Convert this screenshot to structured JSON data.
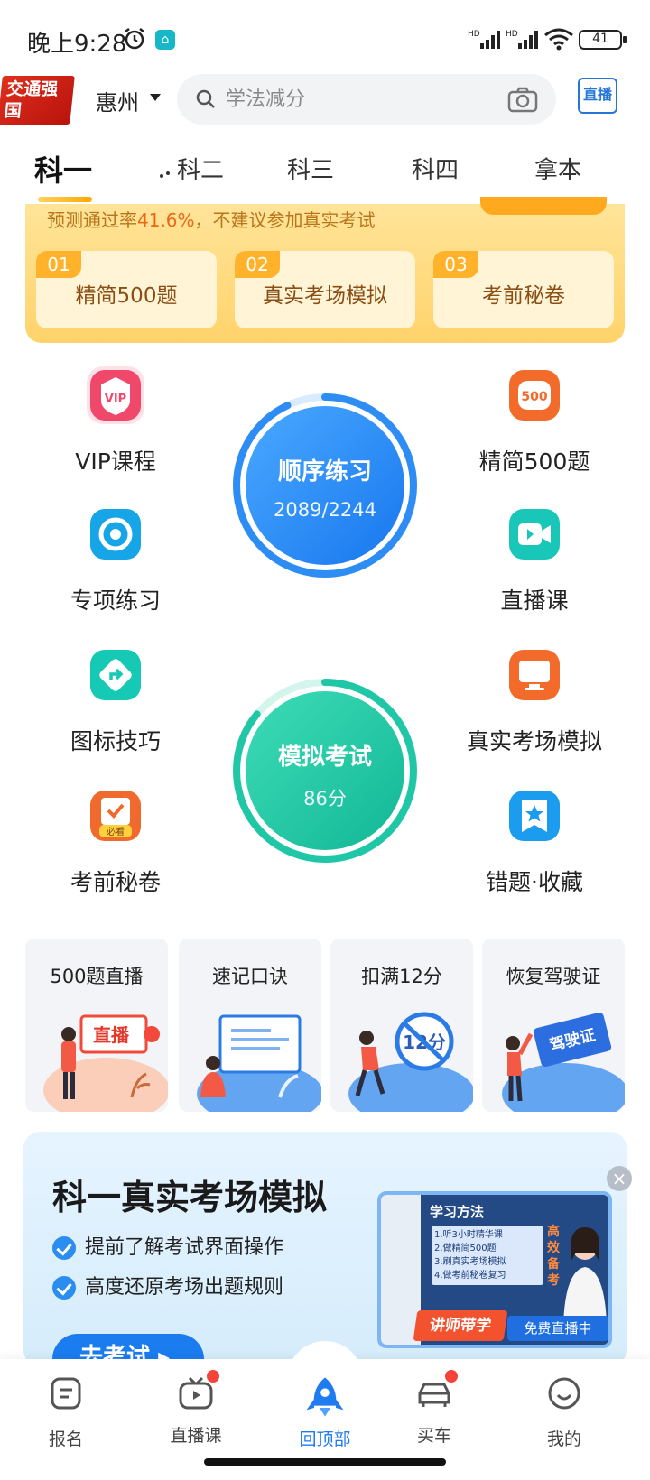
{
  "status_bar": {
    "time": "晚上9:28",
    "signal1": "HD",
    "signal2": "HD",
    "battery": "41"
  },
  "header": {
    "logo_text": "交通强国",
    "city": "惠州",
    "search_placeholder": "学法减分",
    "live_label": "直播"
  },
  "tabs": [
    {
      "label": "科一",
      "active": true
    },
    {
      "label": "科二",
      "active": false
    },
    {
      "label": "科三",
      "active": false
    },
    {
      "label": "科四",
      "active": false
    },
    {
      "label": "拿本",
      "active": false
    }
  ],
  "prediction": {
    "text_before": "预测通过率",
    "rate": "41.6%",
    "text_after": "，不建议参加真实考试",
    "tiles": [
      {
        "num": "01",
        "label": "精简500题"
      },
      {
        "num": "02",
        "label": "真实考场模拟"
      },
      {
        "num": "03",
        "label": "考前秘卷"
      }
    ]
  },
  "grid": {
    "left": [
      {
        "label": "VIP课程",
        "icon": "vip-icon",
        "color": "#f0486a"
      },
      {
        "label": "专项练习",
        "icon": "target-icon",
        "color": "#16a5e6"
      },
      {
        "label": "图标技巧",
        "icon": "sign-arrow-icon",
        "color": "#15c9b4"
      },
      {
        "label": "考前秘卷",
        "icon": "exam-paper-icon",
        "color": "#f06a2e"
      }
    ],
    "right": [
      {
        "label": "精简500题",
        "icon": "500-icon",
        "color": "#f26b2b"
      },
      {
        "label": "直播课",
        "icon": "video-icon",
        "color": "#18c7b8"
      },
      {
        "label": "真实考场模拟",
        "icon": "monitor-icon",
        "color": "#f26b2b"
      },
      {
        "label": "错题·收藏",
        "icon": "star-bookmark-icon",
        "color": "#1b9cee"
      }
    ],
    "sequence": {
      "title": "顺序练习",
      "value": "2089/2244",
      "progress": 0.93
    },
    "mock": {
      "title": "模拟考试",
      "value": "86分",
      "progress": 0.86
    }
  },
  "features": [
    {
      "title": "500题直播",
      "art_text": "直播"
    },
    {
      "title": "速记口诀",
      "art_text": ""
    },
    {
      "title": "扣满12分",
      "art_text": "12分"
    },
    {
      "title": "恢复驾驶证",
      "art_text": "驾驶证"
    }
  ],
  "promo": {
    "title": "科一真实考场模拟",
    "points": [
      "提前了解考试界面操作",
      "高度还原考场出题规则"
    ],
    "cta": "去考试",
    "video_title": "学习方法",
    "video_steps": [
      "1.听3小时精华课",
      "2.做精简500题",
      "3.刷真实考场模拟",
      "4.做考前秘卷复习"
    ],
    "video_side": "高效备考",
    "video_banner": "讲师带学",
    "video_badge": "免费直播中"
  },
  "bottom_nav": [
    {
      "label": "报名",
      "icon": "form-icon",
      "dot": false,
      "active": false
    },
    {
      "label": "直播课",
      "icon": "tv-icon",
      "dot": true,
      "active": false
    },
    {
      "label": "回顶部",
      "icon": "rocket-icon",
      "dot": false,
      "active": true
    },
    {
      "label": "买车",
      "icon": "car-icon",
      "dot": true,
      "active": false
    },
    {
      "label": "我的",
      "icon": "smile-icon",
      "dot": false,
      "active": false
    }
  ],
  "colors": {
    "accent": "#1f7bf0",
    "warning": "#e86a18",
    "badge": "#f4433a"
  }
}
